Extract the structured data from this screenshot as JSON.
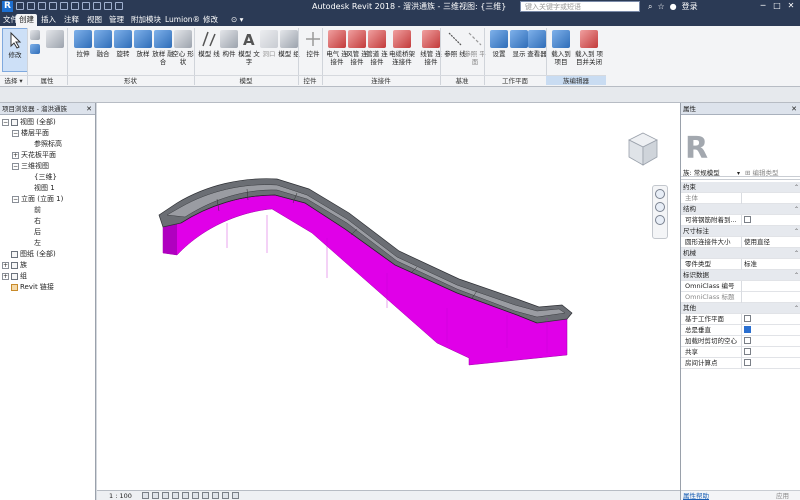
{
  "titlebar": {
    "logo": "R",
    "title": "Autodesk Revit 2018 -   溜洪通族 - 三维视图: {三维}",
    "search_placeholder": "键入关键字或短语",
    "login": "登录",
    "win_min": "─",
    "win_max": "□",
    "win_close": "✕"
  },
  "tabs": [
    {
      "label": "文件"
    },
    {
      "label": "创建"
    },
    {
      "label": "插入"
    },
    {
      "label": "注释"
    },
    {
      "label": "视图"
    },
    {
      "label": "管理"
    },
    {
      "label": "附加模块"
    },
    {
      "label": "Lumion®"
    },
    {
      "label": "修改"
    },
    {
      "label": "⊙ ▾"
    }
  ],
  "ribbon": {
    "buttons": [
      {
        "label": "修改",
        "icon": "cursor-icon"
      },
      {
        "label": "",
        "icon": "type-icon"
      },
      {
        "label": "",
        "icon": "family-icon"
      },
      {
        "label": "拉伸",
        "icon": "extrusion-icon"
      },
      {
        "label": "融合",
        "icon": "blend-icon"
      },
      {
        "label": "旋转",
        "icon": "revolve-icon"
      },
      {
        "label": "放样",
        "icon": "sweep-icon"
      },
      {
        "label": "放样 融合",
        "icon": "swept-blend-icon"
      },
      {
        "label": "空心 形状",
        "icon": "void-icon"
      },
      {
        "label": "模型 线",
        "icon": "model-line-icon"
      },
      {
        "label": "构件",
        "icon": "component-icon"
      },
      {
        "label": "模型 文字",
        "icon": "model-text-icon"
      },
      {
        "label": "洞口",
        "icon": "opening-icon"
      },
      {
        "label": "模型 组",
        "icon": "model-group-icon"
      },
      {
        "label": "控件",
        "icon": "control-icon"
      },
      {
        "label": "电气 连接件",
        "icon": "electrical-connector-icon"
      },
      {
        "label": "风管 连接件",
        "icon": "duct-connector-icon"
      },
      {
        "label": "管道 连接件",
        "icon": "pipe-connector-icon"
      },
      {
        "label": "电缆桥架 连接件",
        "icon": "cable-tray-connector-icon"
      },
      {
        "label": "线管 连接件",
        "icon": "conduit-connector-icon"
      },
      {
        "label": "参照 线",
        "icon": "reference-line-icon"
      },
      {
        "label": "参照 平面",
        "icon": "reference-plane-icon"
      },
      {
        "label": "设置",
        "icon": "set-icon"
      },
      {
        "label": "显示",
        "icon": "show-icon"
      },
      {
        "label": "查看器",
        "icon": "viewer-icon"
      },
      {
        "label": "载入到 项目",
        "icon": "load-into-project-icon"
      },
      {
        "label": "载入到 项目并关闭",
        "icon": "load-and-close-icon"
      }
    ],
    "panels": {
      "select": "选择 ▾",
      "properties": "属性",
      "forms": "形状",
      "model": "模型",
      "control": "控件",
      "connectors": "连接件",
      "datum": "基准",
      "work_plane": "工作平面",
      "family_editor": "族编辑器"
    }
  },
  "browser": {
    "title": "项目浏览器 - 溜洪通族",
    "close": "✕",
    "nodes": [
      {
        "label": "视图 (全部)",
        "toggle": "−",
        "level": 0
      },
      {
        "label": "楼层平面",
        "toggle": "−",
        "level": 1
      },
      {
        "label": "参照标高",
        "toggle": "",
        "level": 2
      },
      {
        "label": "天花板平面",
        "toggle": "+",
        "level": 1
      },
      {
        "label": "三维视图",
        "toggle": "−",
        "level": 1
      },
      {
        "label": "{三维}",
        "toggle": "",
        "level": 2
      },
      {
        "label": "视图 1",
        "toggle": "",
        "level": 2
      },
      {
        "label": "立面 (立面 1)",
        "toggle": "−",
        "level": 1
      },
      {
        "label": "前",
        "toggle": "",
        "level": 2
      },
      {
        "label": "右",
        "toggle": "",
        "level": 2
      },
      {
        "label": "后",
        "toggle": "",
        "level": 2
      },
      {
        "label": "左",
        "toggle": "",
        "level": 2
      },
      {
        "label": "图纸 (全部)",
        "toggle": "",
        "level": 0
      },
      {
        "label": "族",
        "toggle": "+",
        "level": 0
      },
      {
        "label": "组",
        "toggle": "+",
        "level": 0
      },
      {
        "label": "Revit 链接",
        "toggle": "",
        "level": 0
      }
    ]
  },
  "status": {
    "scale": "1 : 100"
  },
  "properties": {
    "title": "属性",
    "close": "✕",
    "type_letter": "R",
    "family_label": "族: 常规模型",
    "family_dropdown": "▾",
    "edit_type": "⊞ 编辑类型",
    "rows": [
      {
        "k": "约束",
        "v": "",
        "section": true
      },
      {
        "k": "主体",
        "v": "",
        "dim": true
      },
      {
        "k": "结构",
        "v": "",
        "section": true
      },
      {
        "k": "可将钢筋附着到...",
        "v": "",
        "check": "off"
      },
      {
        "k": "尺寸标注",
        "v": "",
        "section": true
      },
      {
        "k": "圆形连接件大小",
        "v": "使用直径"
      },
      {
        "k": "机械",
        "v": "",
        "section": true
      },
      {
        "k": "零件类型",
        "v": "标准"
      },
      {
        "k": "标识数据",
        "v": "",
        "section": true
      },
      {
        "k": "OmniClass 编号",
        "v": ""
      },
      {
        "k": "OmniClass 标题",
        "v": "",
        "dim": true
      },
      {
        "k": "其他",
        "v": "",
        "section": true
      },
      {
        "k": "基于工作平面",
        "v": "",
        "check": "off"
      },
      {
        "k": "总是垂直",
        "v": "",
        "check": "on"
      },
      {
        "k": "加载时剪切的空心",
        "v": "",
        "check": "off"
      },
      {
        "k": "共享",
        "v": "",
        "check": "off"
      },
      {
        "k": "房间计算点",
        "v": "",
        "check": "off"
      }
    ],
    "help": "属性帮助",
    "apply": "应用"
  },
  "colors": {
    "accent_magenta": "#e000e8",
    "model_gray": "#6b6e74",
    "titlebar": "#2b3a55"
  }
}
